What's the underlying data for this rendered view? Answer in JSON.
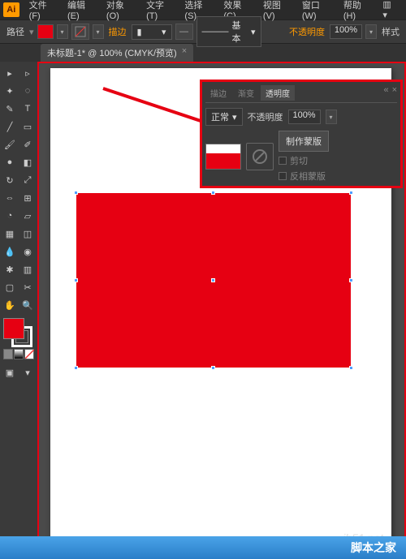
{
  "menu": {
    "file": "文件(F)",
    "edit": "编辑(E)",
    "object": "对象(O)",
    "type": "文字(T)",
    "select": "选择(S)",
    "effect": "效果(C)",
    "view": "视图(V)",
    "window": "窗口(W)",
    "help": "帮助(H)"
  },
  "options": {
    "path_label": "路径",
    "stroke_color": "#e60012",
    "stroke_label": "描边",
    "basic_label": "基本",
    "opacity_label": "不透明度",
    "opacity_value": "100%",
    "style_label": "样式"
  },
  "tab": {
    "title": "未标题-1* @ 100% (CMYK/预览)"
  },
  "panel": {
    "tab_stroke": "描边",
    "tab_gradient": "渐变",
    "tab_opacity": "透明度",
    "blend_mode": "正常",
    "opacity_label": "不透明度",
    "opacity_value": "100%",
    "make_mask": "制作蒙版",
    "clip": "剪切",
    "invert": "反相蒙版"
  },
  "watermark": "jb51.net",
  "footer": "脚本之家"
}
